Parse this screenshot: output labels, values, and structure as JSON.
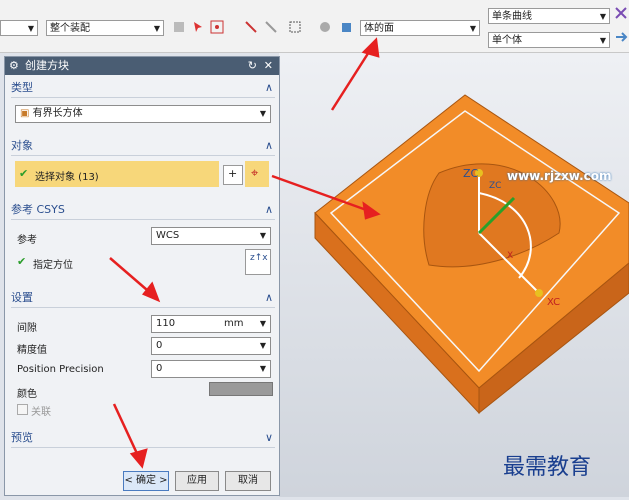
{
  "toolbar": {
    "filter_left": "",
    "assembly_scope": "整个装配",
    "snap_option": "体的面",
    "curve_rule": "单条曲线",
    "body_rule": "单个体"
  },
  "dialog": {
    "title": "创建方块",
    "type_section": {
      "title": "类型",
      "value": "有界长方体"
    },
    "object_section": {
      "title": "对象",
      "select_label": "选择对象 (13)"
    },
    "csys_section": {
      "title": "参考 CSYS",
      "ref_label": "参考",
      "ref_value": "WCS",
      "orient_label": "指定方位"
    },
    "settings_section": {
      "title": "设置",
      "gap_label": "间隙",
      "gap_value": "110",
      "gap_unit": "mm",
      "precision_label": "精度值",
      "precision_value": "0",
      "position_precision_label": "Position Precision",
      "position_precision_value": "0",
      "color_label": "颜色",
      "associate_label": "关联"
    },
    "preview_section": {
      "title": "预览"
    },
    "buttons": {
      "ok": "< 确定 >",
      "apply": "应用",
      "cancel": "取消"
    }
  },
  "viewport": {
    "axis_zc": "ZC",
    "axis_zc_small": "ZC",
    "axis_xc": "XC",
    "axis_x": "X",
    "watermark_url": "www.rjzxw.com",
    "watermark_brand": "最需教育"
  },
  "colors": {
    "block": "#f28c28",
    "arrow": "#e62020",
    "accent": "#2b4f8f"
  }
}
